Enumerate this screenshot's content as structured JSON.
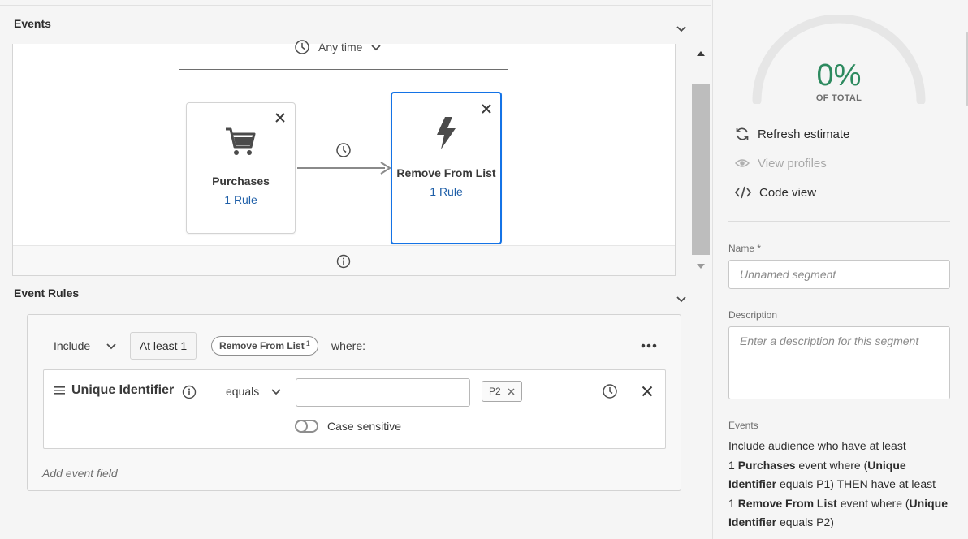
{
  "events_section": {
    "title": "Events"
  },
  "time_filter": {
    "label": "Any time"
  },
  "events": [
    {
      "name": "Purchases",
      "rules": "1 Rule",
      "icon": "cart-icon"
    },
    {
      "name": "Remove From List",
      "rules": "1 Rule",
      "icon": "lightning-icon"
    }
  ],
  "event_rules_section": {
    "title": "Event Rules"
  },
  "rule": {
    "include_mode": "Include",
    "count": "At least 1",
    "event_pill": "Remove From List",
    "event_pill_count": "1",
    "where_label": "where:",
    "field": {
      "name": "Unique Identifier",
      "operator": "equals",
      "value_input": "",
      "values": [
        "P2"
      ],
      "case_sensitive_label": "Case sensitive",
      "case_sensitive": false
    },
    "add_field_label": "Add event field"
  },
  "estimate": {
    "percent": "0%",
    "label": "OF TOTAL"
  },
  "actions": {
    "refresh": "Refresh estimate",
    "view_profiles": "View profiles",
    "code_view": "Code view"
  },
  "form": {
    "name_label": "Name *",
    "name_placeholder": "Unnamed segment",
    "description_label": "Description",
    "description_placeholder": "Enter a description for this segment"
  },
  "summary": {
    "label": "Events",
    "line1": "Include audience who have at least",
    "p1_count": "1",
    "p1_event": "Purchases",
    "p1_where": "event where (",
    "p1_field": "Unique Identifier",
    "p1_cond": "equals P1)",
    "then": "THEN",
    "then_rest": "have at least",
    "p2_count": "1",
    "p2_event": "Remove From List",
    "p2_where": "event where (",
    "p2_field": "Unique Identifier",
    "p2_cond": "equals P2)"
  },
  "colors": {
    "accent_blue": "#1473e6",
    "link_blue": "#1f5fa8",
    "estimate_green": "#2d8a5f"
  }
}
